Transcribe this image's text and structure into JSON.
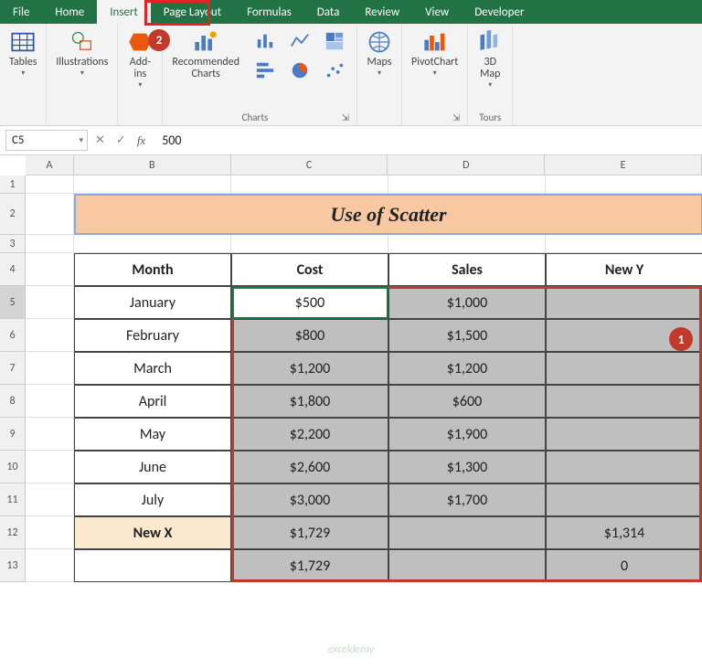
{
  "tabs": {
    "file": "File",
    "home": "Home",
    "insert": "Insert",
    "pagelayout": "Page Layout",
    "formulas": "Formulas",
    "data": "Data",
    "review": "Review",
    "view": "View",
    "developer": "Developer"
  },
  "ribbon": {
    "tables": "Tables",
    "illustrations": "Illustrations",
    "addins": "Add-\nins",
    "recCharts": "Recommended\nCharts",
    "chartsGroup": "Charts",
    "maps": "Maps",
    "pivotChart": "PivotChart",
    "threeDMap": "3D\nMap",
    "tours": "Tours"
  },
  "namebox": "C5",
  "formula": "500",
  "cols": {
    "A": "A",
    "B": "B",
    "C": "C",
    "D": "D",
    "E": "E"
  },
  "rows": [
    "1",
    "2",
    "3",
    "4",
    "5",
    "6",
    "7",
    "8",
    "9",
    "10",
    "11",
    "12",
    "13"
  ],
  "title": "Use of Scatter",
  "headers": {
    "month": "Month",
    "cost": "Cost",
    "sales": "Sales",
    "newy": "New Y"
  },
  "data": [
    {
      "month": "January",
      "cost": "$500",
      "sales": "$1,000",
      "newy": ""
    },
    {
      "month": "February",
      "cost": "$800",
      "sales": "$1,500",
      "newy": ""
    },
    {
      "month": "March",
      "cost": "$1,200",
      "sales": "$1,200",
      "newy": ""
    },
    {
      "month": "April",
      "cost": "$1,800",
      "sales": "$600",
      "newy": ""
    },
    {
      "month": "May",
      "cost": "$2,200",
      "sales": "$1,900",
      "newy": ""
    },
    {
      "month": "June",
      "cost": "$2,600",
      "sales": "$1,300",
      "newy": ""
    },
    {
      "month": "July",
      "cost": "$3,000",
      "sales": "$1,700",
      "newy": ""
    }
  ],
  "newxRow": {
    "label": "New X",
    "cost": "$1,729",
    "sales": "",
    "newy": "$1,314"
  },
  "lastRow": {
    "month": "",
    "cost": "$1,729",
    "sales": "",
    "newy": "0"
  },
  "callouts": {
    "c1": "1",
    "c2": "2"
  },
  "watermark": "exceldemy"
}
